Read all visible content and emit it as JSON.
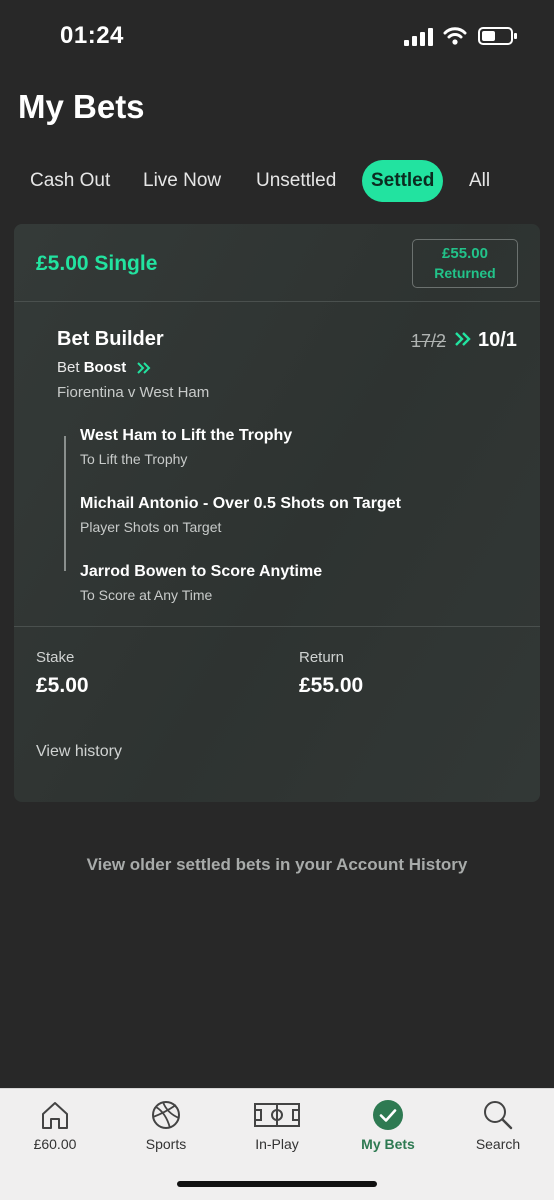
{
  "status_bar": {
    "time": "01:24"
  },
  "page": {
    "title": "My Bets"
  },
  "tabs": [
    {
      "label": "Cash Out",
      "active": false
    },
    {
      "label": "Live Now",
      "active": false
    },
    {
      "label": "Unsettled",
      "active": false
    },
    {
      "label": "Settled",
      "active": true
    },
    {
      "label": "All",
      "active": false
    }
  ],
  "bet": {
    "type": "£5.00 Single",
    "returned_amount": "£55.00",
    "returned_label": "Returned",
    "builder_title": "Bet Builder",
    "boost_prefix": "Bet",
    "boost_word": "Boost",
    "match": "Fiorentina v West Ham",
    "odds_old": "17/2",
    "odds_new": "10/1",
    "legs": [
      {
        "title": "West Ham to Lift the Trophy",
        "subtitle": "To Lift the Trophy"
      },
      {
        "title": "Michail Antonio - Over 0.5 Shots on Target",
        "subtitle": "Player Shots on Target"
      },
      {
        "title": "Jarrod Bowen to Score Anytime",
        "subtitle": "To Score at Any Time"
      }
    ],
    "stake_label": "Stake",
    "stake_value": "£5.00",
    "return_label": "Return",
    "return_value": "£55.00",
    "view_history": "View history"
  },
  "older_link": "View older settled bets in your Account History",
  "bottom_nav": [
    {
      "label": "£60.00",
      "icon": "home-icon",
      "active": false
    },
    {
      "label": "Sports",
      "icon": "football-icon",
      "active": false
    },
    {
      "label": "In-Play",
      "icon": "pitch-icon",
      "active": false
    },
    {
      "label": "My Bets",
      "icon": "checkmark-circle-icon",
      "active": true
    },
    {
      "label": "Search",
      "icon": "search-icon",
      "active": false
    }
  ],
  "colors": {
    "accent": "#22e3a0",
    "background": "#282828",
    "nav_active": "#2e7a52"
  }
}
